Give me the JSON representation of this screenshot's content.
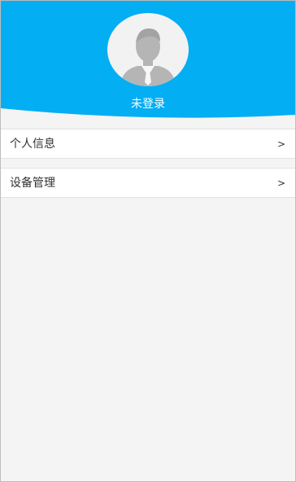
{
  "profile": {
    "status_text": "未登录",
    "avatar_icon": "user-avatar-placeholder-icon"
  },
  "menu": {
    "items": [
      {
        "label": "个人信息",
        "chevron": ">"
      },
      {
        "label": "设备管理",
        "chevron": ">"
      }
    ]
  },
  "colors": {
    "header_blue": "#03aef3",
    "page_bg": "#f4f4f4",
    "item_bg": "#ffffff"
  }
}
